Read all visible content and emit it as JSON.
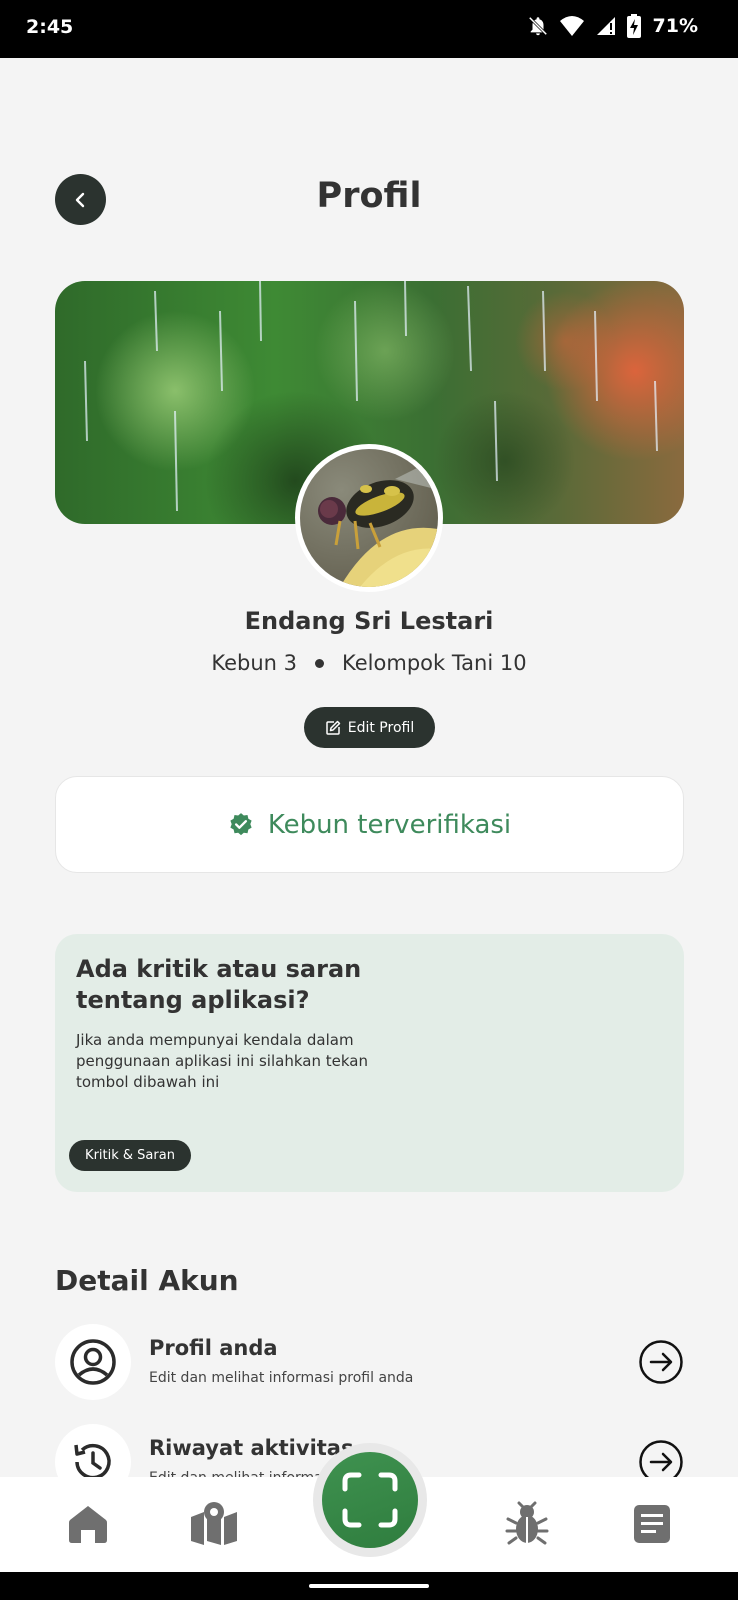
{
  "status_bar": {
    "time": "2:45",
    "battery": "71%",
    "icons": [
      "bell-off-icon",
      "wifi-icon",
      "signal-icon",
      "battery-charging-icon"
    ]
  },
  "header": {
    "title": "Profil"
  },
  "profile": {
    "name": "Endang Sri Lestari",
    "garden": "Kebun 3",
    "group": "Kelompok Tani 10",
    "edit_label": "Edit Profil"
  },
  "verified": {
    "label": "Kebun terverifikasi",
    "color": "#3e8a5c"
  },
  "feedback": {
    "title": "Ada kritik atau saran tentang aplikasi?",
    "description": "Jika anda mempunyai kendala dalam penggunaan aplikasi ini silahkan tekan tombol dibawah ini",
    "button": "Kritik & Saran"
  },
  "account": {
    "section_title": "Detail Akun",
    "items": [
      {
        "title": "Profil anda",
        "subtitle": "Edit dan melihat informasi profil anda",
        "icon": "user-circle-icon"
      },
      {
        "title": "Riwayat aktivitas",
        "subtitle": "Edit dan melihat informasi",
        "icon": "history-icon"
      }
    ]
  },
  "bottom_nav": {
    "items": [
      "home-icon",
      "map-icon",
      "scan-icon",
      "bug-icon",
      "document-icon"
    ],
    "accent": "#3f9250"
  }
}
